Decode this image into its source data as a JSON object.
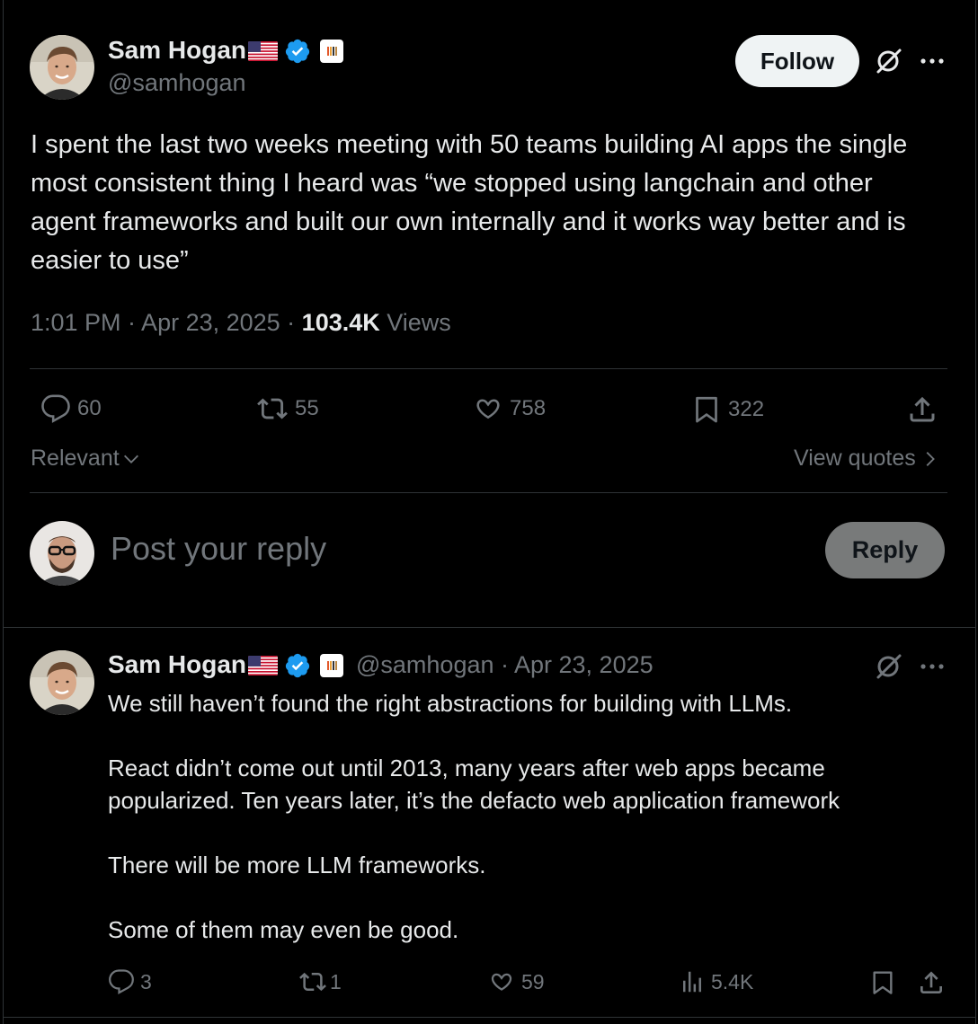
{
  "main_post": {
    "author_name": "Sam Hogan",
    "author_handle": "@samhogan",
    "follow_label": "Follow",
    "text": "I spent the last two weeks meeting with 50 teams building AI apps the single most consistent thing I heard was “we stopped using langchain and other agent frameworks and built our own internally and it works way better and is easier to use”",
    "timestamp": "1:01 PM · Apr 23, 2025 · ",
    "views_count": "103.4K",
    "views_label": " Views",
    "replies": "60",
    "reposts": "55",
    "likes": "758",
    "bookmarks": "322"
  },
  "filters": {
    "sort_label": "Relevant",
    "view_quotes_label": "View quotes"
  },
  "composer": {
    "placeholder": "Post your reply",
    "reply_label": "Reply"
  },
  "reply_post": {
    "author_name": "Sam Hogan",
    "author_handle": "@samhogan",
    "date": " · Apr 23, 2025",
    "text": "We still haven’t found the right abstractions for building with LLMs.\n\nReact didn’t come out until 2013, many years after web apps became popularized. Ten years later, it’s the defacto web application framework\n\nThere will be more LLM frameworks.\n\nSome of them may even be good.",
    "replies": "3",
    "reposts": "1",
    "likes": "59",
    "views": "5.4K"
  },
  "colors": {
    "background": "#000000",
    "text_primary": "#e7e9ea",
    "text_secondary": "#71767b",
    "verified_blue": "#1d9bf0",
    "divider": "#2f3336"
  },
  "icons": [
    "grok-icon",
    "more-icon",
    "reply-icon",
    "repost-icon",
    "like-icon",
    "bookmark-icon",
    "share-icon",
    "views-icon",
    "verified-badge-icon",
    "us-flag-icon",
    "chevron-down-icon",
    "chevron-right-icon"
  ]
}
